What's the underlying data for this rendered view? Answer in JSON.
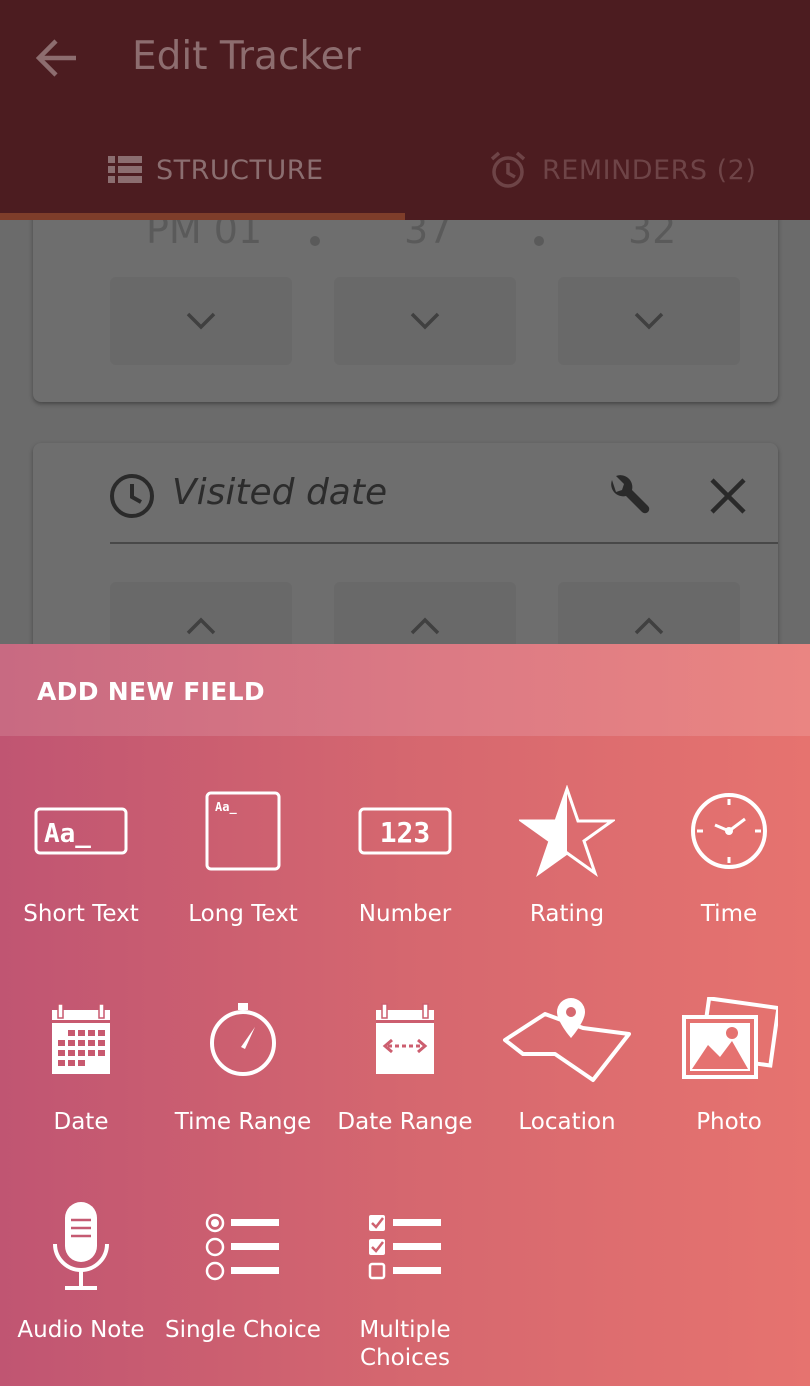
{
  "app_bar": {
    "title": "Edit Tracker",
    "tabs": [
      {
        "label": "STRUCTURE",
        "icon": "list-icon",
        "active": true
      },
      {
        "label": "REMINDERS (2)",
        "icon": "alarm-icon",
        "active": false
      }
    ]
  },
  "background": {
    "time_card": {
      "hour": "PM 01",
      "minute": "37",
      "second": "32"
    },
    "date_card": {
      "label": "Visited date",
      "icon": "clock-icon"
    }
  },
  "sheet": {
    "title": "ADD NEW FIELD",
    "fields": [
      {
        "label": "Short Text",
        "icon": "short-text-icon",
        "icon_text": "Aa_"
      },
      {
        "label": "Long Text",
        "icon": "long-text-icon",
        "icon_text": "Aa_"
      },
      {
        "label": "Number",
        "icon": "number-icon",
        "icon_text": "123"
      },
      {
        "label": "Rating",
        "icon": "star-icon"
      },
      {
        "label": "Time",
        "icon": "clock-icon"
      },
      {
        "label": "Date",
        "icon": "calendar-icon"
      },
      {
        "label": "Time Range",
        "icon": "stopwatch-icon"
      },
      {
        "label": "Date Range",
        "icon": "date-range-icon"
      },
      {
        "label": "Location",
        "icon": "map-pin-icon"
      },
      {
        "label": "Photo",
        "icon": "photo-icon"
      },
      {
        "label": "Audio Note",
        "icon": "microphone-icon"
      },
      {
        "label": "Single Choice",
        "icon": "radio-list-icon"
      },
      {
        "label": "Multiple Choices",
        "icon": "checkbox-list-icon"
      }
    ]
  },
  "colors": {
    "app_bar": "#4c1c20",
    "tab_indicator": "#7e3d2a",
    "sheet_start": "#c05572",
    "sheet_end": "#e6736f"
  }
}
